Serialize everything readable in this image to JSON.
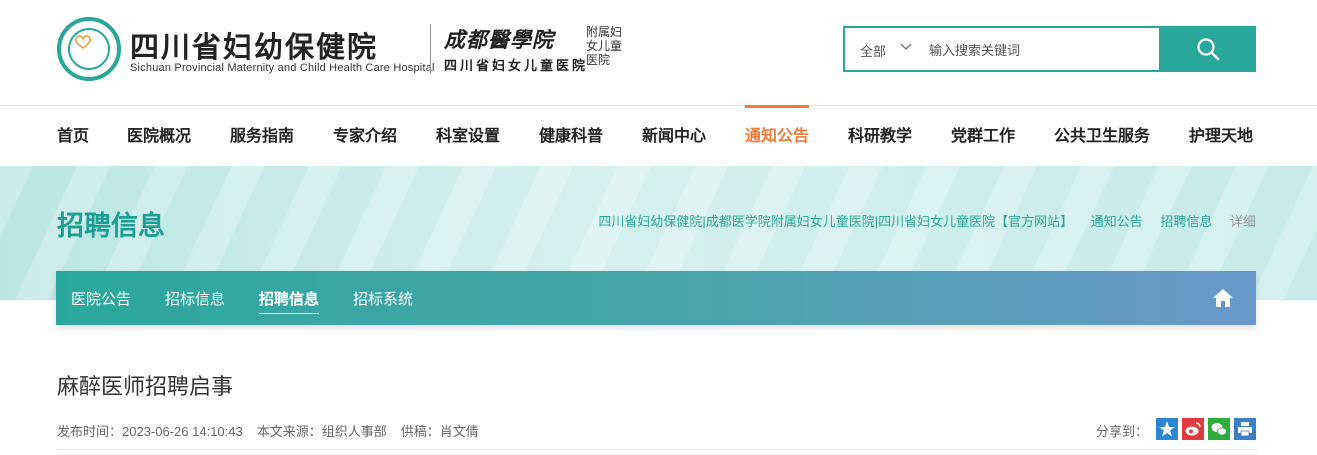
{
  "header": {
    "logo_cn": "四川省妇幼保健院",
    "logo_en": "Sichuan Provincial Maternity and Child Health Care Hospital",
    "calligraphy": "成都醫學院",
    "affiliate_line": "附属妇女儿童医院",
    "affiliate_name": "四川省妇女儿童医院"
  },
  "search": {
    "scope": "全部",
    "placeholder": "输入搜索关键词"
  },
  "nav": {
    "items": [
      "首页",
      "医院概况",
      "服务指南",
      "专家介绍",
      "科室设置",
      "健康科普",
      "新闻中心",
      "通知公告",
      "科研教学",
      "党群工作",
      "公共卫生服务",
      "护理天地"
    ],
    "active": "通知公告"
  },
  "banner": {
    "title": "招聘信息",
    "breadcrumb": [
      "四川省妇幼保健院|成都医学院附属妇女儿童医院|四川省妇女儿童医院【官方网站】",
      "通知公告",
      "招聘信息",
      "详细"
    ]
  },
  "subnav": {
    "items": [
      "医院公告",
      "招标信息",
      "招聘信息",
      "招标系统"
    ],
    "active": "招聘信息"
  },
  "article": {
    "title": "麻醉医师招聘启事",
    "publish_label": "发布时间：",
    "publish_time": "2023-06-26 14:10:43",
    "source_label": "本文来源：",
    "source": "组织人事部",
    "author_label": "供稿：",
    "author": "肖文倩",
    "share_label": "分享到："
  },
  "colors": {
    "brand": "#2aa79b",
    "active_nav": "#f07a36"
  },
  "icons": [
    "search-icon",
    "chevron-down-icon",
    "home-icon",
    "qzone-star-icon",
    "weibo-icon",
    "wechat-icon",
    "print-icon"
  ]
}
